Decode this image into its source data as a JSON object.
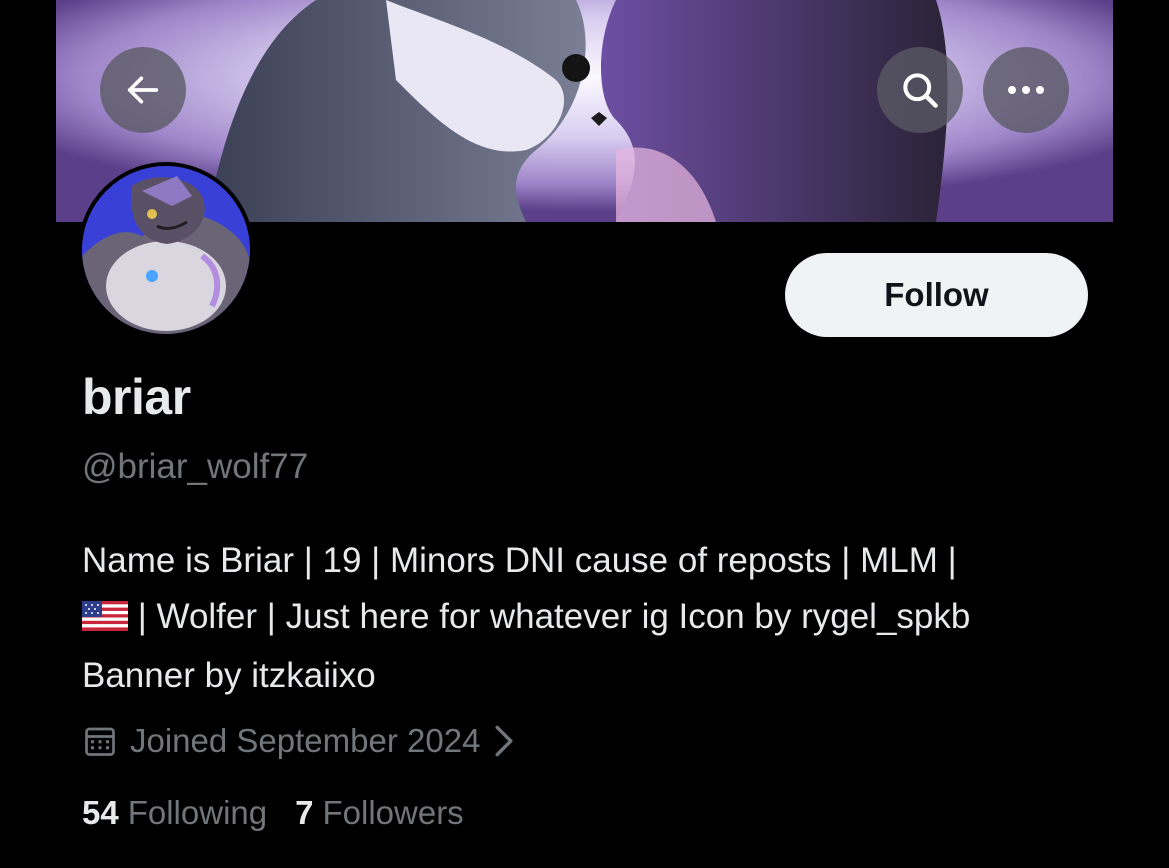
{
  "profile": {
    "display_name": "briar",
    "handle": "@briar_wolf77",
    "bio_line1": "Name is Briar | 19 | Minors DNI cause of reposts | MLM |",
    "bio_line2": " | Wolfer | Just here for whatever ig Icon by rygel_spkb",
    "bio_line3": "Banner by itzkaiixo",
    "joined": "Joined September 2024",
    "following_count": "54",
    "following_label": "Following",
    "followers_count": "7",
    "followers_label": "Followers"
  },
  "actions": {
    "follow_label": "Follow"
  },
  "icons": {
    "back": "arrow-left-icon",
    "search": "search-icon",
    "more": "more-horizontal-icon",
    "calendar": "calendar-icon",
    "chevron": "chevron-right-icon",
    "flag": "us-flag-emoji"
  },
  "colors": {
    "background": "#000000",
    "text_primary": "#e7e9ea",
    "text_secondary": "#71767b",
    "follow_button_bg": "#eff3f4",
    "follow_button_text": "#0f1419"
  }
}
